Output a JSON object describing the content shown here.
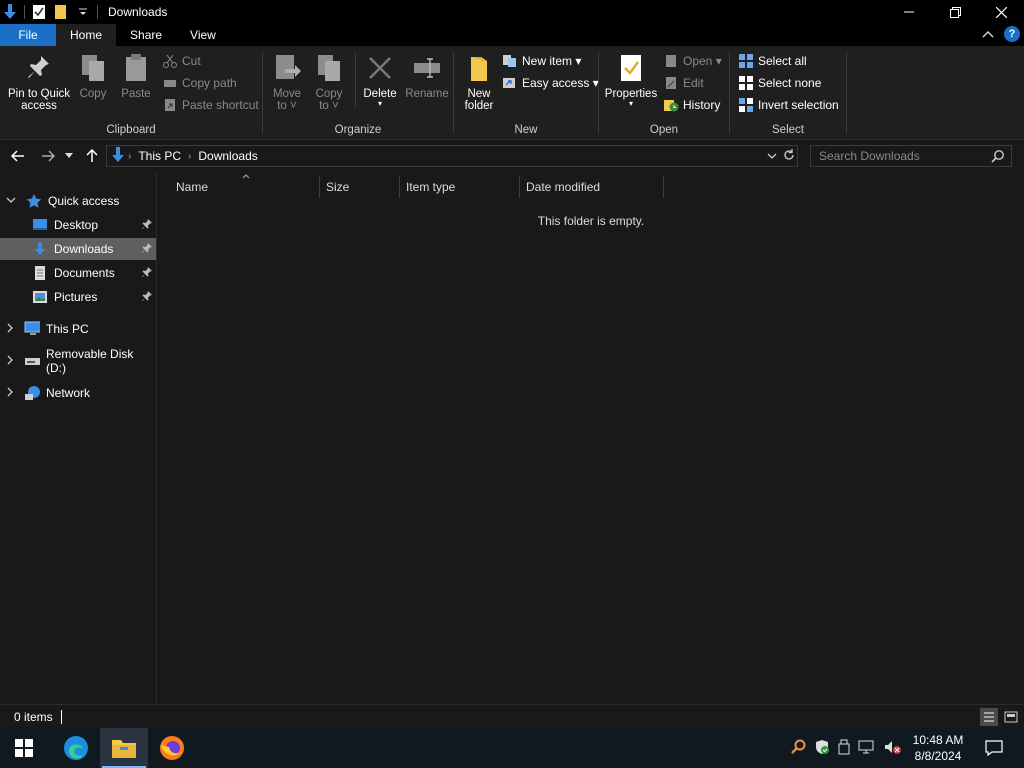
{
  "window": {
    "title": "Downloads"
  },
  "tabs": {
    "file": "File",
    "home": "Home",
    "share": "Share",
    "view": "View"
  },
  "ribbon": {
    "clipboard": {
      "label": "Clipboard",
      "pin": [
        "Pin to Quick",
        "access"
      ],
      "copy": "Copy",
      "paste": "Paste",
      "cut": "Cut",
      "copy_path": "Copy path",
      "paste_shortcut": "Paste shortcut"
    },
    "organize": {
      "label": "Organize",
      "move_to": [
        "Move",
        "to ˅"
      ],
      "copy_to": [
        "Copy",
        "to ˅"
      ],
      "delete": "Delete",
      "rename": "Rename"
    },
    "new": {
      "label": "New",
      "new_folder": [
        "New",
        "folder"
      ],
      "new_item": "New item ▾",
      "easy_access": "Easy access ▾"
    },
    "open": {
      "label": "Open",
      "properties": "Properties",
      "open": "Open ▾",
      "edit": "Edit",
      "history": "History"
    },
    "select": {
      "label": "Select",
      "select_all": "Select all",
      "select_none": "Select none",
      "invert": "Invert selection"
    }
  },
  "address": {
    "crumbs": [
      "This PC",
      "Downloads"
    ],
    "search_placeholder": "Search Downloads"
  },
  "navpane": {
    "quick_access": "Quick access",
    "items": [
      {
        "label": "Desktop"
      },
      {
        "label": "Downloads"
      },
      {
        "label": "Documents"
      },
      {
        "label": "Pictures"
      }
    ],
    "this_pc": "This PC",
    "removable": "Removable Disk (D:)",
    "network": "Network"
  },
  "columns": [
    "Name",
    "Size",
    "Item type",
    "Date modified"
  ],
  "content": {
    "empty_message": "This folder is empty."
  },
  "status": {
    "items": "0 items"
  },
  "taskbar": {
    "time": "10:48 AM",
    "date": "8/8/2024"
  },
  "colors": {
    "accent": "#1a6fc7",
    "folder": "#f2c94c",
    "selected": "#5f5f5f"
  }
}
